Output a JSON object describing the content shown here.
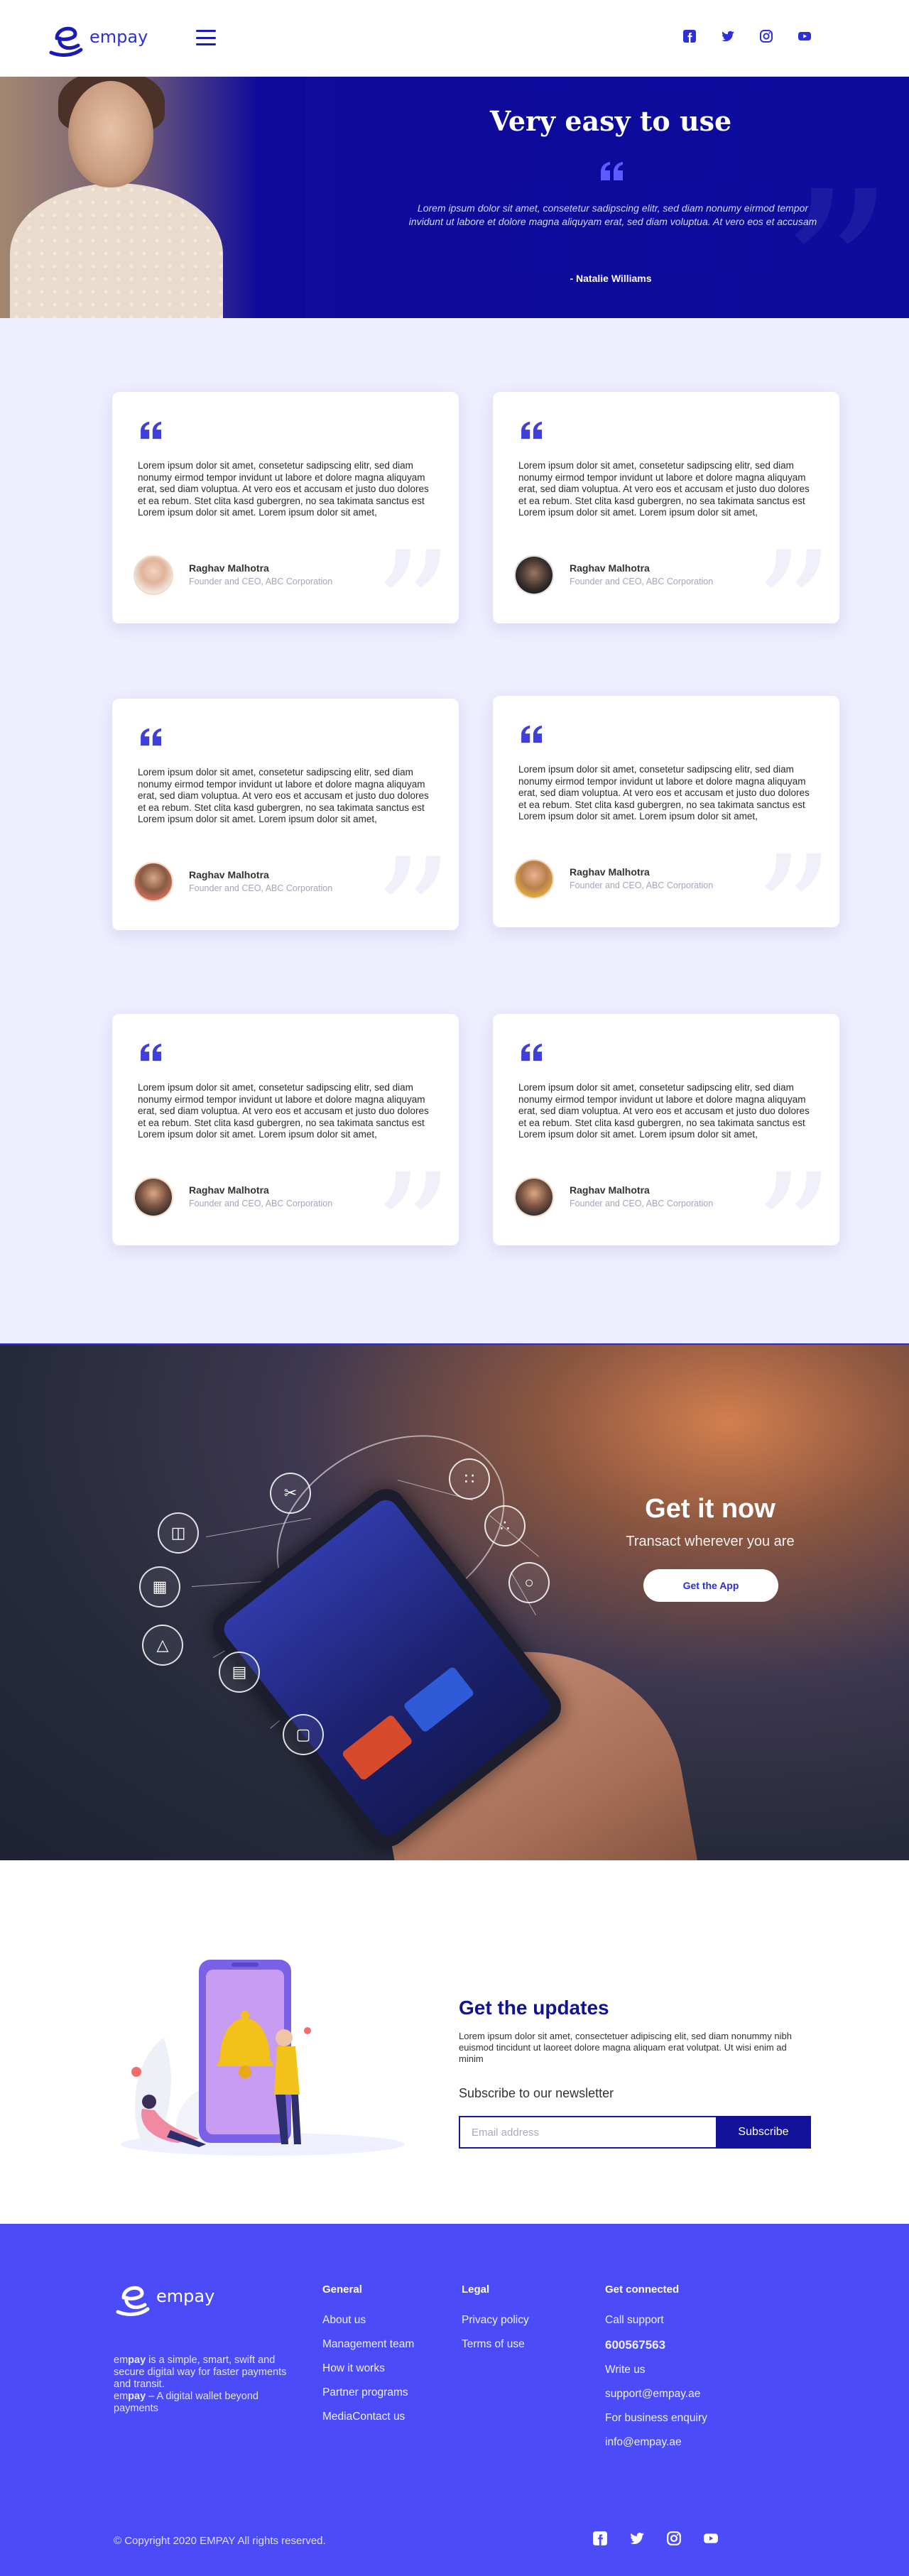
{
  "brand": {
    "name": "empay",
    "accent": "#2f2fd8",
    "dark_blue": "#0d0a9c",
    "footer_blue": "#4b4bf8"
  },
  "header": {
    "menu_icon": "hamburger-icon",
    "social": [
      "facebook-icon",
      "twitter-icon",
      "instagram-icon",
      "youtube-icon"
    ]
  },
  "hero": {
    "title": "Very easy to use",
    "quote": "Lorem ipsum dolor sit amet, consetetur sadipscing elitr, sed diam nonumy eirmod tempor invidunt ut labore et dolore magna aliquyam erat, sed diam voluptua. At vero eos et accusam",
    "author": "- Natalie Williams"
  },
  "testimonials": [
    {
      "text": "Lorem ipsum dolor sit amet, consetetur sadipscing elitr, sed diam nonumy eirmod tempor invidunt ut labore et dolore magna aliquyam erat, sed diam voluptua. At vero eos et accusam et justo duo dolores et ea rebum. Stet clita kasd gubergren, no sea takimata sanctus est Lorem ipsum dolor sit amet. Lorem ipsum dolor sit amet,",
      "name": "Raghav Malhotra",
      "role": "Founder and CEO, ABC Corporation"
    },
    {
      "text": "Lorem ipsum dolor sit amet, consetetur sadipscing elitr, sed diam nonumy eirmod tempor invidunt ut labore et dolore magna aliquyam erat, sed diam voluptua. At vero eos et accusam et justo duo dolores et ea rebum. Stet clita kasd gubergren, no sea takimata sanctus est Lorem ipsum dolor sit amet. Lorem ipsum dolor sit amet,",
      "name": "Raghav Malhotra",
      "role": "Founder and CEO, ABC Corporation"
    },
    {
      "text": "Lorem ipsum dolor sit amet, consetetur sadipscing elitr, sed diam nonumy eirmod tempor invidunt ut labore et dolore magna aliquyam erat, sed diam voluptua. At vero eos et accusam et justo duo dolores et ea rebum. Stet clita kasd gubergren, no sea takimata sanctus est Lorem ipsum dolor sit amet. Lorem ipsum dolor sit amet,",
      "name": "Raghav Malhotra",
      "role": "Founder and CEO, ABC Corporation"
    },
    {
      "text": "Lorem ipsum dolor sit amet, consetetur sadipscing elitr, sed diam nonumy eirmod tempor invidunt ut labore et dolore magna aliquyam erat, sed diam voluptua. At vero eos et accusam et justo duo dolores et ea rebum. Stet clita kasd gubergren, no sea takimata sanctus est Lorem ipsum dolor sit amet. Lorem ipsum dolor sit amet,",
      "name": "Raghav Malhotra",
      "role": "Founder and CEO, ABC Corporation"
    },
    {
      "text": "Lorem ipsum dolor sit amet, consetetur sadipscing elitr, sed diam nonumy eirmod tempor invidunt ut labore et dolore magna aliquyam erat, sed diam voluptua. At vero eos et accusam et justo duo dolores et ea rebum. Stet clita kasd gubergren, no sea takimata sanctus est Lorem ipsum dolor sit amet. Lorem ipsum dolor sit amet,",
      "name": "Raghav Malhotra",
      "role": "Founder and CEO, ABC Corporation"
    },
    {
      "text": "Lorem ipsum dolor sit amet, consetetur sadipscing elitr, sed diam nonumy eirmod tempor invidunt ut labore et dolore magna aliquyam erat, sed diam voluptua. At vero eos et accusam et justo duo dolores et ea rebum. Stet clita kasd gubergren, no sea takimata sanctus est Lorem ipsum dolor sit amet. Lorem ipsum dolor sit amet,",
      "name": "Raghav Malhotra",
      "role": "Founder and CEO, ABC Corporation"
    }
  ],
  "getit": {
    "title": "Get it now",
    "subtitle": "Transact wherever you are",
    "button": "Get the App"
  },
  "updates": {
    "title": "Get the updates",
    "text": "Lorem ipsum dolor sit amet, consectetuer adipiscing elit, sed diam nonummy nibh euismod tincidunt ut laoreet dolore magna aliquam erat volutpat. Ut wisi enim ad minim",
    "newsletter_label": "Subscribe to our newsletter",
    "email_placeholder": "Email address",
    "subscribe_button": "Subscribe"
  },
  "footer": {
    "about_brand_1": "em",
    "about_brand_2": "pay",
    "about_1": " is a simple, smart, swift and secure digital way for faster payments and transit.",
    "about_2": " – A digital wallet beyond payments",
    "general": {
      "heading": "General",
      "links": [
        "About us",
        "Management team",
        "How it works",
        "Partner programs",
        "MediaContact us"
      ]
    },
    "legal": {
      "heading": "Legal",
      "links": [
        "Privacy policy",
        "Terms of use"
      ]
    },
    "connected": {
      "heading": "Get connected",
      "call_label": "Call support",
      "phone": "600567563",
      "write_label": "Write us",
      "support_email": "support@empay.ae",
      "business_label": "For business enquiry",
      "info_email": "info@empay.ae"
    },
    "copyright": "© Copyright 2020 EMPAY All rights reserved."
  }
}
